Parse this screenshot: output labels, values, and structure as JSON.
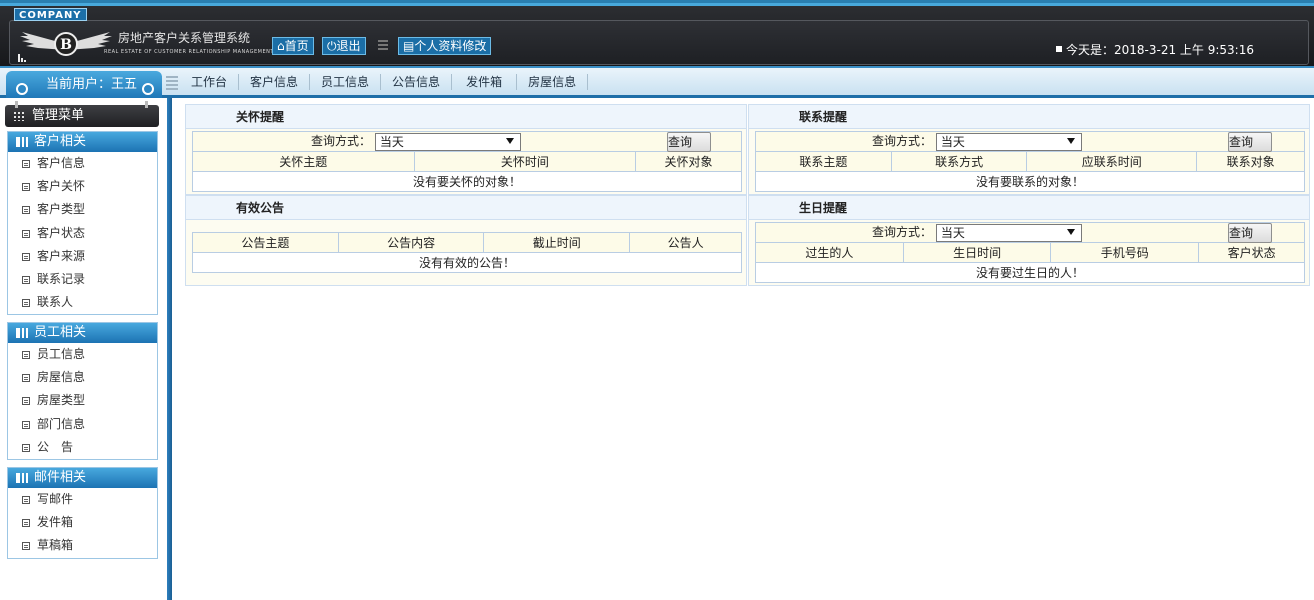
{
  "header": {
    "company": "COMPANY",
    "system_title": "房地产客户关系管理系统",
    "system_subtitle": "REAL ESTATE OF CUSTOMER RELATIONSHIP MANAGEMENT SYSTEM",
    "home_label": "首页",
    "logout_label": "退出",
    "profile_label": "个人资料修改",
    "today_text": "今天是：2018-3-21 上午 9:53:16"
  },
  "nav": {
    "current_user": "当前用户：王五",
    "items": [
      "工作台",
      "客户信息",
      "员工信息",
      "公告信息",
      "发件箱",
      "房屋信息"
    ]
  },
  "sidebar": {
    "menu_title": "管理菜单",
    "groups": [
      {
        "title": "客户相关",
        "items": [
          "客户信息",
          "客户关怀",
          "客户类型",
          "客户状态",
          "客户来源",
          "联系记录",
          "联系人"
        ]
      },
      {
        "title": "员工相关",
        "items": [
          "员工信息",
          "房屋信息",
          "房屋类型",
          "部门信息",
          "公　告"
        ]
      },
      {
        "title": "邮件相关",
        "items": [
          "写邮件",
          "发件箱",
          "草稿箱"
        ]
      }
    ]
  },
  "panels": {
    "care": {
      "title": "关怀提醒",
      "query_label": "查询方式：",
      "select_value": "当天",
      "query_button": "查询",
      "columns": [
        "关怀主题",
        "关怀时间",
        "关怀对象"
      ],
      "empty": "没有要关怀的对象！"
    },
    "contact": {
      "title": "联系提醒",
      "query_label": "查询方式：",
      "select_value": "当天",
      "query_button": "查询",
      "columns": [
        "联系主题",
        "联系方式",
        "应联系时间",
        "联系对象"
      ],
      "empty": "没有要联系的对象！"
    },
    "notice": {
      "title": "有效公告",
      "columns": [
        "公告主题",
        "公告内容",
        "截止时间",
        "公告人"
      ],
      "empty": "没有有效的公告！"
    },
    "birthday": {
      "title": "生日提醒",
      "query_label": "查询方式：",
      "select_value": "当天",
      "query_button": "查询",
      "columns": [
        "过生的人",
        "生日时间",
        "手机号码",
        "客户状态"
      ],
      "empty": "没有要过生日的人！"
    }
  },
  "colors": {
    "accent": "#1c73b3",
    "header_bg": "#1e2024",
    "panel_bg": "#fdfcf1"
  }
}
